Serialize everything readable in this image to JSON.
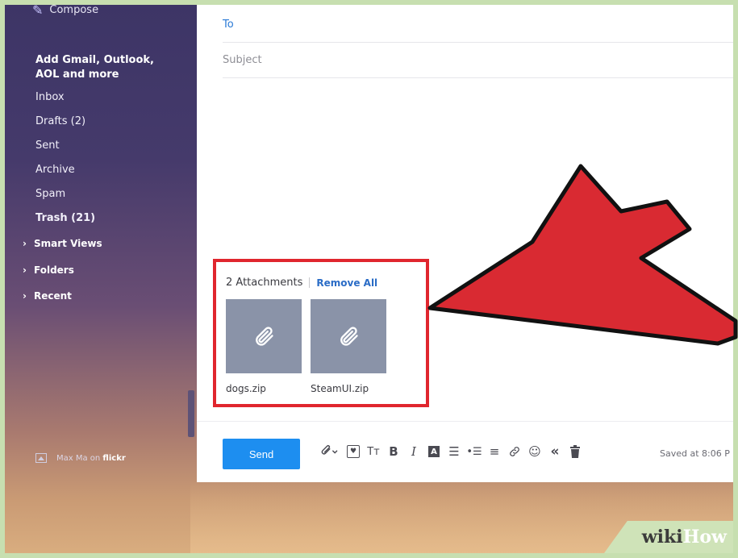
{
  "colors": {
    "accent_blue": "#1d8ef0",
    "link_blue": "#2a6cc6",
    "highlight_red": "#e0262e",
    "sidebar_bg": "#3d3566",
    "attachment_tile": "#8a93a8"
  },
  "sidebar": {
    "compose_label": "Compose",
    "compose_icon": "pencil-icon",
    "add_accounts": "Add Gmail, Outlook, AOL and more",
    "items": [
      {
        "label": "Inbox"
      },
      {
        "label": "Drafts (2)"
      },
      {
        "label": "Sent"
      },
      {
        "label": "Archive"
      },
      {
        "label": "Spam"
      },
      {
        "label": "Trash (21)"
      }
    ],
    "groups": [
      {
        "label": "Smart Views"
      },
      {
        "label": "Folders"
      },
      {
        "label": "Recent"
      }
    ],
    "photo_credit": {
      "prefix": "Max Ma on ",
      "source": "flickr",
      "icon": "image-icon"
    }
  },
  "compose": {
    "to_label": "To",
    "subject_placeholder": "Subject",
    "attachments": {
      "count_label": "2 Attachments",
      "remove_all": "Remove All",
      "files": [
        {
          "name": "dogs.zip",
          "icon": "paperclip-icon"
        },
        {
          "name": "SteamUI.zip",
          "icon": "paperclip-icon"
        }
      ]
    },
    "toolbar": {
      "send_label": "Send",
      "saved_text": "Saved at 8:06 P",
      "tools": [
        {
          "name": "attach-icon",
          "glyph": "📎▾"
        },
        {
          "name": "stationery-icon",
          "glyph": "♥"
        },
        {
          "name": "font-size-icon",
          "glyph": "Tт"
        },
        {
          "name": "bold-icon",
          "glyph": "B"
        },
        {
          "name": "italic-icon",
          "glyph": "I"
        },
        {
          "name": "text-color-icon",
          "glyph": "A"
        },
        {
          "name": "bullet-list-icon",
          "glyph": "☰"
        },
        {
          "name": "indent-icon",
          "glyph": "⇥"
        },
        {
          "name": "align-icon",
          "glyph": "≡"
        },
        {
          "name": "link-icon",
          "glyph": "🔗"
        },
        {
          "name": "emoji-icon",
          "glyph": "☺"
        },
        {
          "name": "show-original-icon",
          "glyph": "«"
        },
        {
          "name": "trash-icon",
          "glyph": "🗑"
        }
      ]
    }
  },
  "watermark": {
    "part1": "wiki",
    "part2": "How"
  }
}
